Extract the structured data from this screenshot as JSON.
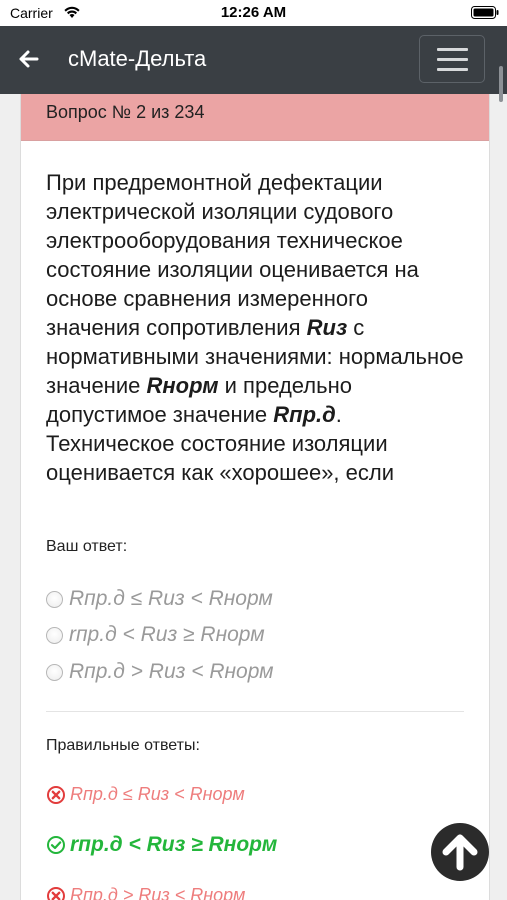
{
  "status_bar": {
    "carrier": "Carrier",
    "time": "12:26 AM",
    "icons": [
      "wifi-icon",
      "battery-icon"
    ]
  },
  "app_bar": {
    "title": "cMate-Дельта",
    "back_icon": "arrow-left-icon",
    "menu_icon": "hamburger-menu-icon"
  },
  "question": {
    "header": "Вопрос № 2 из 234",
    "text_parts": [
      "При предремонтной дефектации электрической изоляции судового электрооборудования техническое состояние изоляции оценивается на основе сравнения измеренного значения сопротивления ",
      "Rиз",
      " с нормативными значениями: нормальное значение ",
      "Rнорм",
      " и предельно допустимое значение ",
      "Rпр.д",
      ". Техническое состояние изоляции оценивается как «хорошее», если"
    ],
    "your_answer_label": "Ваш ответ:",
    "options": [
      "Rпр.д ≤ Rиз < Rнорм",
      "rпр.д < Rиз ≥ Rнорм",
      "Rпр.д > Rиз < Rнорм"
    ],
    "correct_answers_label": "Правильные ответы:",
    "answers": [
      {
        "text": "Rпр.д ≤ Rиз < Rнорм",
        "status": "wrong"
      },
      {
        "text": "rпр.д < Rиз ≥ Rнорм",
        "status": "correct"
      },
      {
        "text": "Rпр.д > Rиз < Rнорм",
        "status": "wrong"
      }
    ]
  },
  "colors": {
    "app_bar": "#3a3f44",
    "header_bg": "#eba4a4",
    "wrong": "#ee7d7d",
    "correct": "#23b63b",
    "fab": "#2b2b2b"
  },
  "scroll_top_icon": "arrow-up-icon"
}
